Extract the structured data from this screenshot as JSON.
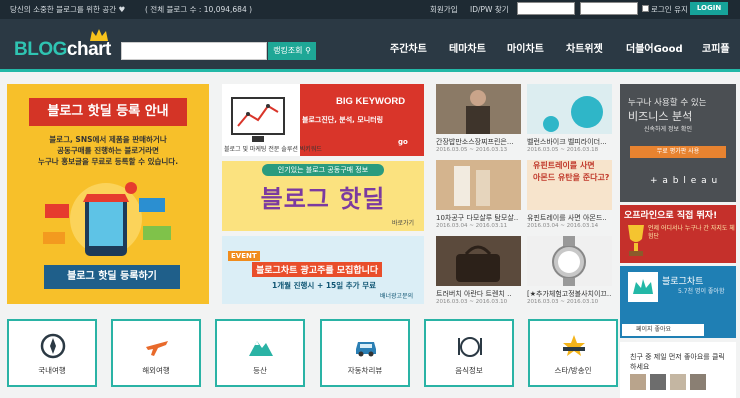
{
  "topbar": {
    "tagline": "당신의 소중한 블로그를 위한 공간 ♥",
    "total": "( 전체 블로그 수 : 10,094,684 )",
    "signup": "회원가입",
    "find": "ID/PW 찾기",
    "keep_login": "로그인 유지",
    "login": "LOGIN"
  },
  "header": {
    "logo_blog": "BLOG",
    "logo_chart": "chart",
    "search_button": "랭킹조회",
    "nav": [
      "주간차트",
      "테마차트",
      "마이차트",
      "차트위젯",
      "더블어Good",
      "코피플"
    ]
  },
  "banners": {
    "main": {
      "title": "블로그 핫딜 등록 안내",
      "desc_line1": "블로그, SNS에서 제품을 판매하거나",
      "desc_line2": "공동구매를 진행하는 블로거라면",
      "desc_line3": "누구나 홍보글을 무료로 등록할 수 있습니다.",
      "button": "블로그 핫딜 등록하기"
    },
    "big_keyword": {
      "title": "BIG KEYWORD",
      "sub": "블로그 및 마케팅 전문 솔루션 빅키워드",
      "tag": "블로그진단, 분석, 모니터링",
      "go": "go"
    },
    "deal": {
      "pill": "인기있는 블로그 공동구매 정보",
      "title": "블로그 핫딜",
      "more": "바로가기"
    },
    "event": {
      "badge": "EVENT",
      "title": "블로그차트 광고주를 모집합니다",
      "sub": "1개월 진행시 + 15일 추가 무료",
      "more": "배너광고문의"
    }
  },
  "thumbs": [
    {
      "caption": "간장밥만소스장찌프린은...",
      "date": "2016.03.05 ~ 2016.03.13"
    },
    {
      "caption": "벨런스바이크 벨피라이더...",
      "date": "2016.03.05 ~ 2016.03.18"
    },
    {
      "caption": "10차공구 다모살루 탐모살..",
      "date": "2016.03.04 ~ 2016.03.11"
    },
    {
      "caption": "유핀트레이를 사면 아몬드..",
      "date": "2016.03.04 ~ 2016.03.14"
    },
    {
      "caption": "트러버치 아란다 트렌치 ..",
      "date": "2016.03.03 ~ 2016.03.10"
    },
    {
      "caption": "[★추가체험고정볼사치이끄..",
      "date": "2016.03.03 ~ 2016.03.10"
    }
  ],
  "thumb_overlay": {
    "line1": "유핀트레이를 사면",
    "line2": "아몬드 유탄을 준다고?"
  },
  "side_ads": {
    "tableau_t1": "누구나 사용할 수 있는",
    "tableau_t2": "비즈니스 분석",
    "tableau_t3": "신속하게 정보 확인",
    "tableau_btn": "무료 평가판 사용",
    "tableau_brand": "+ a b l e a u",
    "offline_t1": "오프라인으로 직접 뛰자!",
    "offline_t2": "언제 어디서나 누구나 간 자지도 체험단",
    "fb_title": "블로그차트",
    "fb_sub": "5.7천 명이 좋아함",
    "fb_like": "페이지 좋아요",
    "friends": "친구 중 제일 먼저 좋아요를 클릭하세요"
  },
  "categories": [
    {
      "label": "국내여행",
      "icon": "compass-icon"
    },
    {
      "label": "해외여행",
      "icon": "airplane-icon"
    },
    {
      "label": "등산",
      "icon": "mountain-icon"
    },
    {
      "label": "자동차리뷰",
      "icon": "car-icon"
    },
    {
      "label": "음식정보",
      "icon": "dish-icon"
    },
    {
      "label": "스타/방송인",
      "icon": "star-icon"
    }
  ],
  "colors": {
    "accent": "#23b8a7",
    "header": "#2b3944",
    "topbar": "#1e2a33",
    "border": "#2ab3a5"
  }
}
